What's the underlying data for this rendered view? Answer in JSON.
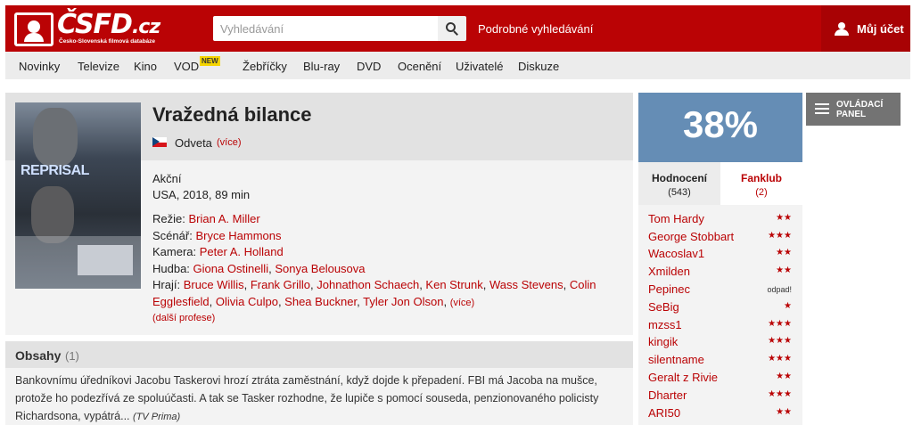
{
  "header": {
    "logo_text": "ČSFD",
    "logo_tld": ".cz",
    "logo_subtitle": "Česko-Slovenská filmová databáze",
    "search_placeholder": "Vyhledávání",
    "advanced_search": "Podrobné vyhledávání",
    "account_label": "Můj účet",
    "brand_color": "#ba0305"
  },
  "nav": {
    "items": [
      "Novinky",
      "Televize",
      "Kino",
      "VOD",
      "Žebříčky",
      "Blu-ray",
      "DVD",
      "Ocenění",
      "Uživatelé",
      "Diskuze"
    ],
    "vod_badge": "NEW"
  },
  "film": {
    "title": "Vražedná bilance",
    "alt_title": "Odveta",
    "alt_more": "(více)",
    "genre": "Akční",
    "origin": "USA, 2018, 89 min",
    "poster_title": "REPRISAL",
    "crew": {
      "directing_label": "Režie:",
      "directing": "Brian A. Miller",
      "screenplay_label": "Scénář:",
      "screenplay": "Bryce Hammons",
      "camera_label": "Kamera:",
      "camera": "Peter A. Holland",
      "music_label": "Hudba:",
      "music_1": "Giona Ostinelli",
      "music_2": "Sonya Belousova",
      "cast_label": "Hrají:",
      "cast": [
        "Bruce Willis",
        "Frank Grillo",
        "Johnathon Schaech",
        "Ken Strunk",
        "Wass Stevens",
        "Colin Egglesfield",
        "Olivia Culpo",
        "Shea Buckner",
        "Tyler Jon Olson"
      ],
      "cast_more": "(více)"
    },
    "more_professions": "(další profese)"
  },
  "plot": {
    "heading": "Obsahy",
    "count": "(1)",
    "text": "Bankovnímu úředníkovi Jacobu Taskerovi hrozí ztráta zaměstnání, když dojde k přepadení. FBI má Jacoba na mušce, protože ho podezřívá ze spoluúčasti. A tak se Tasker rozhodne, že lupiče s pomocí souseda, penzionovaného policisty Richardsona, vypátrá...",
    "source": "(TV Prima)"
  },
  "rating": {
    "value": "38%",
    "color": "#658db5",
    "tab_ratings_label": "Hodnocení",
    "tab_ratings_count": "(543)",
    "tab_fanclub_label": "Fanklub",
    "tab_fanclub_count": "(2)",
    "raters": [
      {
        "name": "Tom Hardy",
        "stars": "★★"
      },
      {
        "name": "George Stobbart",
        "stars": "★★★"
      },
      {
        "name": "Wacoslav1",
        "stars": "★★"
      },
      {
        "name": "Xmilden",
        "stars": "★★"
      },
      {
        "name": "Pepinec",
        "stars": "odpad!"
      },
      {
        "name": "SeBig",
        "stars": "★"
      },
      {
        "name": "mzss1",
        "stars": "★★★"
      },
      {
        "name": "kingik",
        "stars": "★★★"
      },
      {
        "name": "silentname",
        "stars": "★★★"
      },
      {
        "name": "Geralt z Rivie",
        "stars": "★★"
      },
      {
        "name": "Dharter",
        "stars": "★★★"
      },
      {
        "name": "ARI50",
        "stars": "★★"
      }
    ]
  },
  "control_panel": {
    "label": "OVLÁDACÍ PANEL"
  }
}
